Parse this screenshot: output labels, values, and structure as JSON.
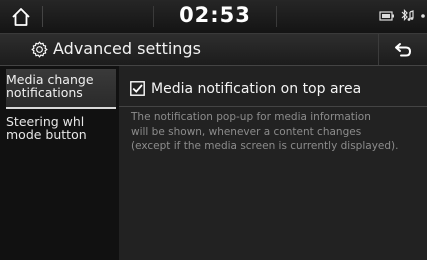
{
  "status": {
    "time": "02:53"
  },
  "header": {
    "title": "Advanced settings"
  },
  "sidebar": {
    "items": [
      {
        "label_line1": "Media change",
        "label_line2": "notifications"
      },
      {
        "label_line1": "Steering whl",
        "label_line2": "mode button"
      }
    ]
  },
  "main": {
    "option_label": "Media notification on top area",
    "option_checked": true,
    "description": [
      "The notification pop-up for media information",
      "will be shown, whenever a content changes",
      "(except if the media screen is currently displayed)."
    ]
  }
}
